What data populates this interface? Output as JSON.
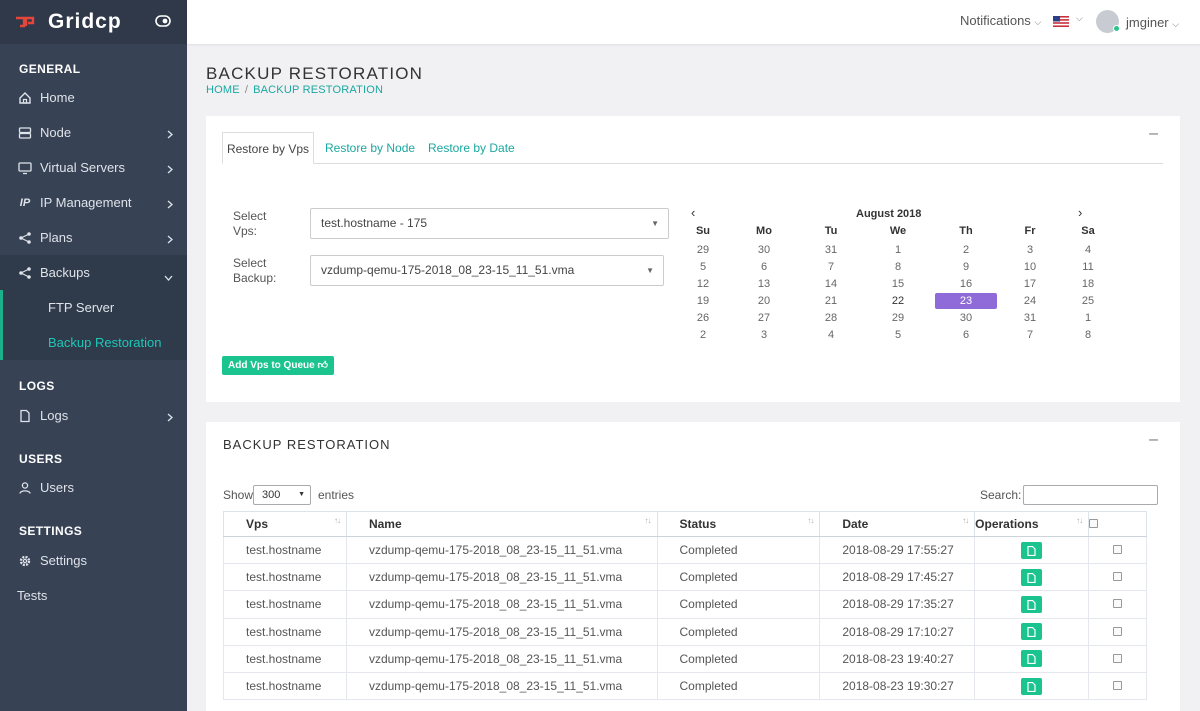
{
  "app": {
    "brand": "Gridcp"
  },
  "sidebar": {
    "sections": {
      "general": "GENERAL",
      "logs": "LOGS",
      "users": "USERS",
      "settings": "SETTINGS"
    },
    "items": {
      "home": "Home",
      "node": "Node",
      "virtual_servers": "Virtual Servers",
      "ip_management": "IP Management",
      "ip_icon_text": "IP",
      "plans": "Plans",
      "backups": "Backups",
      "ftp_server": "FTP Server",
      "backup_restoration": "Backup Restoration",
      "logs": "Logs",
      "users": "Users",
      "settings": "Settings",
      "tests": "Tests"
    }
  },
  "topbar": {
    "notifications": "Notifications",
    "username": "jmginer"
  },
  "page": {
    "title": "BACKUP RESTORATION",
    "breadcrumb": {
      "home": "HOME",
      "current": "BACKUP RESTORATION"
    }
  },
  "restore_card": {
    "tabs": [
      "Restore by Vps",
      "Restore by Node",
      "Restore by Date"
    ],
    "select_vps_label_1": "Select",
    "select_vps_label_2": "Vps:",
    "select_vps_value": "test.hostname - 175",
    "select_backup_label_1": "Select",
    "select_backup_label_2": "Backup:",
    "select_backup_value": "vzdump-qemu-175-2018_08_23-15_11_51.vma",
    "add_button": "Add Vps to Queue",
    "calendar": {
      "month": "August 2018",
      "prev": "‹",
      "next": "›",
      "days_of_week": [
        "Su",
        "Mo",
        "Tu",
        "We",
        "Th",
        "Fr",
        "Sa"
      ],
      "weeks": [
        [
          "29",
          "30",
          "31",
          "1",
          "2",
          "3",
          "4"
        ],
        [
          "5",
          "6",
          "7",
          "8",
          "9",
          "10",
          "11"
        ],
        [
          "12",
          "13",
          "14",
          "15",
          "16",
          "17",
          "18"
        ],
        [
          "19",
          "20",
          "21",
          "22",
          "23",
          "24",
          "25"
        ],
        [
          "26",
          "27",
          "28",
          "29",
          "30",
          "31",
          "1"
        ],
        [
          "2",
          "3",
          "4",
          "5",
          "6",
          "7",
          "8"
        ]
      ],
      "selected_day": "23",
      "today": "22"
    }
  },
  "list_card": {
    "title": "BACKUP RESTORATION",
    "show_label": "Show",
    "page_length": "300",
    "entries_label": "entries",
    "search_label": "Search:",
    "columns": [
      "Vps",
      "Name",
      "Status",
      "Date",
      "Operations"
    ],
    "rows": [
      {
        "vps": "test.hostname",
        "name": "vzdump-qemu-175-2018_08_23-15_11_51.vma",
        "status": "Completed",
        "date": "2018-08-29 17:55:27"
      },
      {
        "vps": "test.hostname",
        "name": "vzdump-qemu-175-2018_08_23-15_11_51.vma",
        "status": "Completed",
        "date": "2018-08-29 17:45:27"
      },
      {
        "vps": "test.hostname",
        "name": "vzdump-qemu-175-2018_08_23-15_11_51.vma",
        "status": "Completed",
        "date": "2018-08-29 17:35:27"
      },
      {
        "vps": "test.hostname",
        "name": "vzdump-qemu-175-2018_08_23-15_11_51.vma",
        "status": "Completed",
        "date": "2018-08-29 17:10:27"
      },
      {
        "vps": "test.hostname",
        "name": "vzdump-qemu-175-2018_08_23-15_11_51.vma",
        "status": "Completed",
        "date": "2018-08-23 19:40:27"
      },
      {
        "vps": "test.hostname",
        "name": "vzdump-qemu-175-2018_08_23-15_11_51.vma",
        "status": "Completed",
        "date": "2018-08-23 19:30:27"
      }
    ]
  },
  "colors": {
    "sidebar": "#374254",
    "accent": "#1bc38e",
    "link": "#1aa8a0",
    "calendar_selected": "#8e6bd8"
  }
}
